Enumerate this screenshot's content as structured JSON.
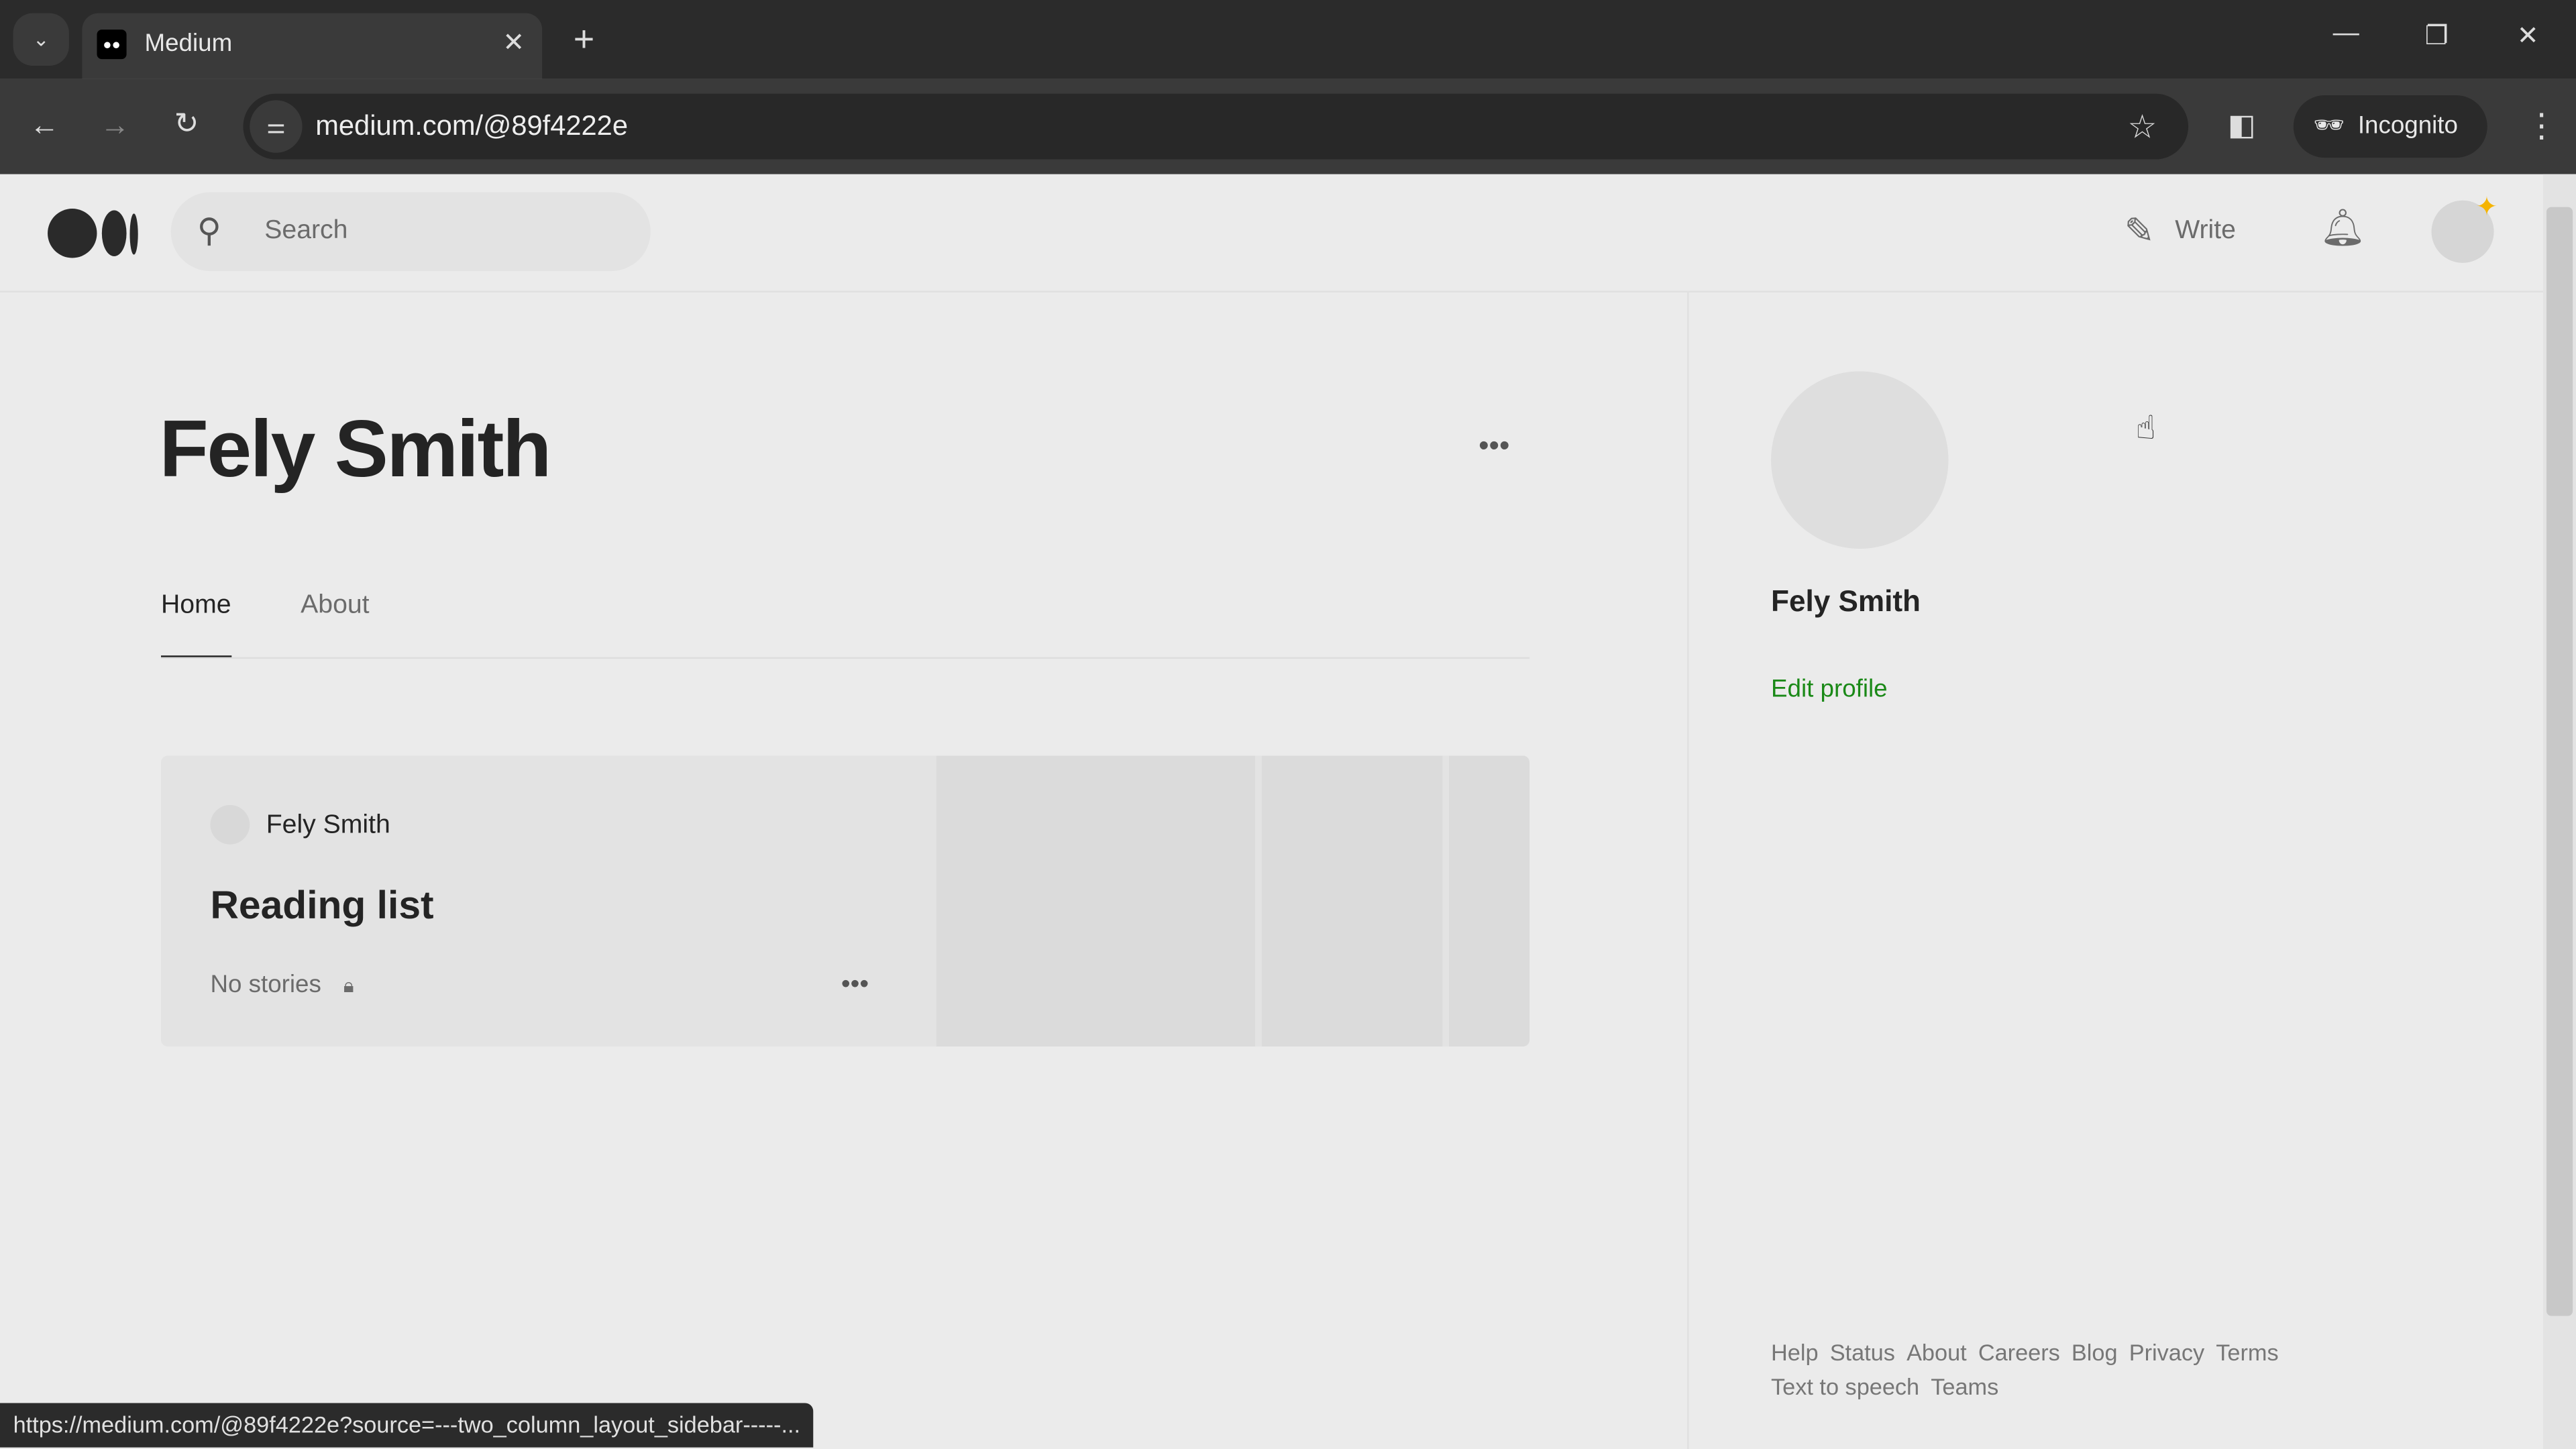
{
  "browser": {
    "tab_title": "Medium",
    "url": "medium.com/@89f4222e",
    "incognito_label": "Incognito",
    "status_url": "https://medium.com/@89f4222e?source=---two_column_layout_sidebar-----..."
  },
  "header": {
    "search_placeholder": "Search",
    "write_label": "Write"
  },
  "profile": {
    "name": "Fely Smith",
    "tabs": [
      {
        "label": "Home",
        "active": true
      },
      {
        "label": "About",
        "active": false
      }
    ]
  },
  "card": {
    "author": "Fely Smith",
    "title": "Reading list",
    "meta": "No stories"
  },
  "sidebar": {
    "name": "Fely Smith",
    "edit_label": "Edit profile",
    "accent": "#1a8917"
  },
  "footer": {
    "links": [
      "Help",
      "Status",
      "About",
      "Careers",
      "Blog",
      "Privacy",
      "Terms",
      "Text to speech",
      "Teams"
    ]
  }
}
